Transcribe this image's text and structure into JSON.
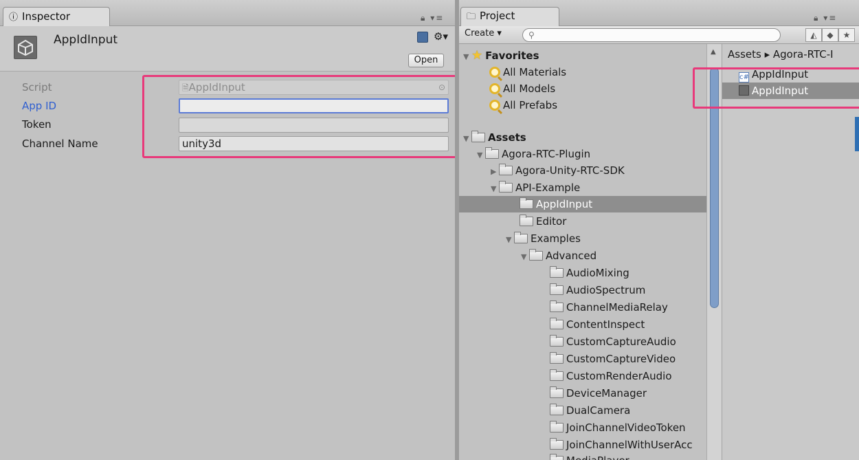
{
  "inspector": {
    "tab_label": "Inspector",
    "object_name": "AppIdInput",
    "open_button": "Open",
    "properties": [
      {
        "label": "Script",
        "value": "AppIdInput"
      },
      {
        "label": "App ID",
        "value": ""
      },
      {
        "label": "Token",
        "value": ""
      },
      {
        "label": "Channel Name",
        "value": "unity3d"
      }
    ]
  },
  "project": {
    "tab_label": "Project",
    "create_label": "Create",
    "search": {
      "placeholder": ""
    },
    "tree": {
      "favorites": "Favorites",
      "all_materials": "All Materials",
      "all_models": "All Models",
      "all_prefabs": "All Prefabs",
      "assets": "Assets",
      "agora_plugin": "Agora-RTC-Plugin",
      "agora_sdk": "Agora-Unity-RTC-SDK",
      "api_example": "API-Example",
      "appidinput": "AppIdInput",
      "editor": "Editor",
      "examples": "Examples",
      "advanced": "Advanced",
      "advanced_items": [
        "AudioMixing",
        "AudioSpectrum",
        "ChannelMediaRelay",
        "ContentInspect",
        "CustomCaptureAudio",
        "CustomCaptureVideo",
        "CustomRenderAudio",
        "DeviceManager",
        "DualCamera",
        "JoinChannelVideoToken",
        "JoinChannelWithUserAcc",
        "MediaPlayer"
      ]
    },
    "breadcrumb": "Assets ▸ Agora-RTC-I",
    "assets": [
      {
        "name": "AppIdInput",
        "type": "script"
      },
      {
        "name": "AppIdInput",
        "type": "scene"
      }
    ]
  },
  "colors": {
    "highlight": "#e8397a",
    "label_blue": "#2f5fd0",
    "selection": "#8e8e8e"
  }
}
